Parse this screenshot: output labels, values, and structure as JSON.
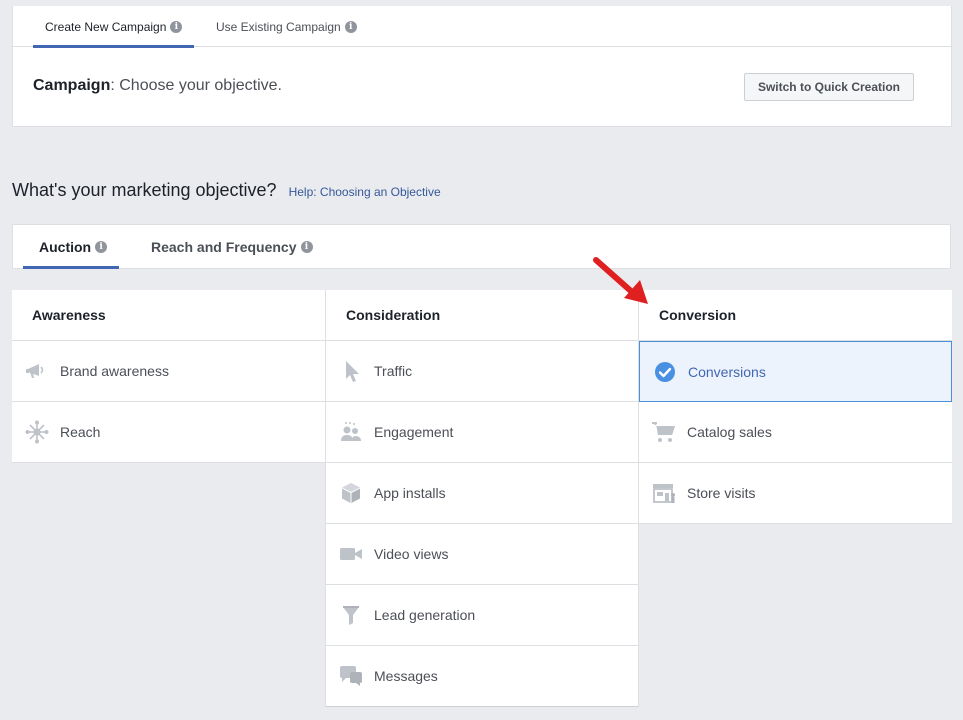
{
  "top_tabs": {
    "create_label": "Create New Campaign",
    "existing_label": "Use Existing Campaign"
  },
  "campaign": {
    "label": "Campaign",
    "separator": ":",
    "subtitle": " Choose your objective.",
    "quick_button": "Switch to Quick Creation"
  },
  "objective": {
    "question": "What's your marketing objective?",
    "help_link": "Help: Choosing an Objective"
  },
  "buy_tabs": {
    "auction": "Auction",
    "reach_frequency": "Reach and Frequency"
  },
  "columns": {
    "awareness": {
      "title": "Awareness",
      "items": [
        "Brand awareness",
        "Reach"
      ]
    },
    "consideration": {
      "title": "Consideration",
      "items": [
        "Traffic",
        "Engagement",
        "App installs",
        "Video views",
        "Lead generation",
        "Messages"
      ]
    },
    "conversion": {
      "title": "Conversion",
      "items": [
        "Conversions",
        "Catalog sales",
        "Store visits"
      ]
    }
  },
  "colors": {
    "accent": "#4267b2",
    "icon_grey": "#bec3c9",
    "selected_check": "#4a90e2",
    "arrow_red": "#e02020"
  }
}
